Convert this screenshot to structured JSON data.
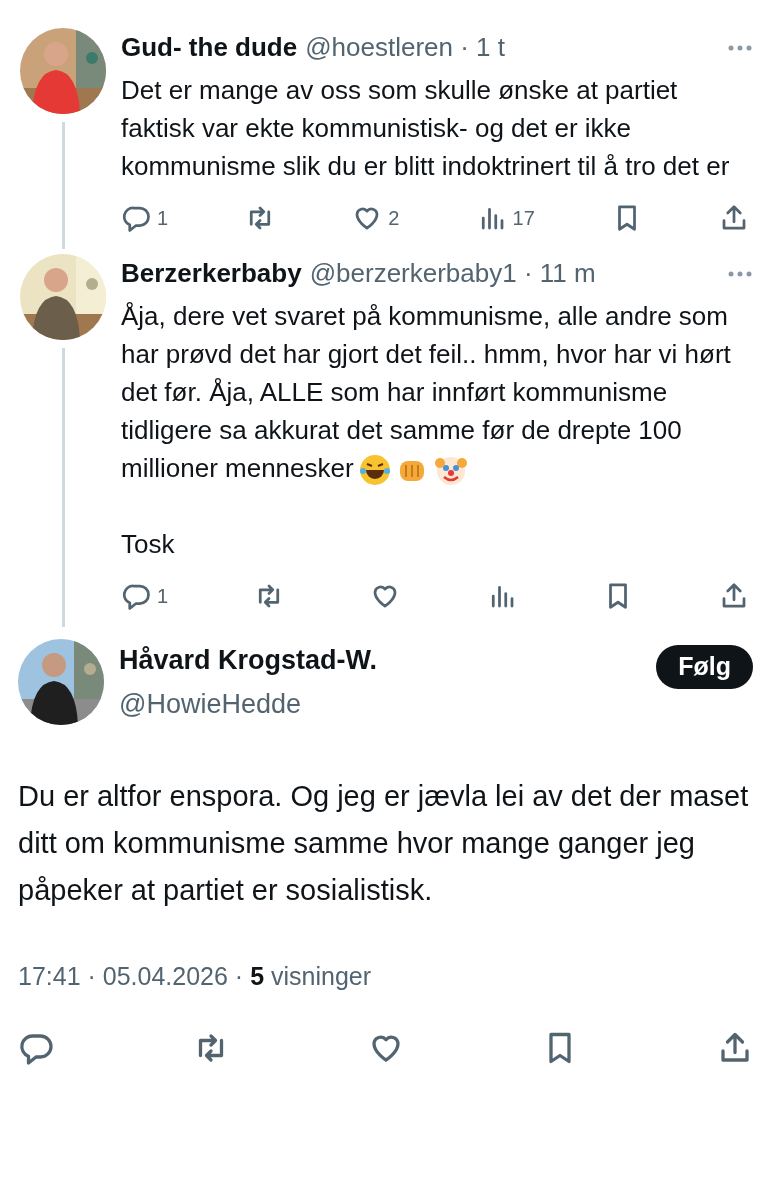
{
  "replies": [
    {
      "name": "Gud- the dude",
      "meta": "@hoestleren · 1 t",
      "paragraphs": [
        "Det er mange av oss som skulle ønske at partiet faktisk var ekte kommunistisk- og det er ikke kommunisme slik du er blitt indoktrinert til å tro det er"
      ],
      "reply_count": "1",
      "like_count": "2",
      "view_count": "17",
      "avatar": {
        "kind": "picture"
      }
    },
    {
      "name": "Berzerkerbaby",
      "meta": "@berzerkerbaby1 · 11 m",
      "paragraphs": [
        "Åja, dere vet svaret på kommunisme, alle andre som har prøvd det har gjort det feil.. hmm, hvor har vi hørt det før. Åja, ALLE som har innført kommunisme tidligere sa akkurat det samme før de drepte 100 millioner mennesker",
        "Tosk"
      ],
      "reply_count": "1",
      "avatar": {
        "kind": "picture"
      }
    }
  ],
  "main_tweet": {
    "name": "Håvard Krogstad-W.",
    "handle": "@HowieHedde",
    "follow_button": "Følg",
    "text": "Du er altfor enspora. Og jeg er jævla lei av det der maset ditt om kommunisme samme hvor mange ganger jeg påpeker at partiet er sosialistisk.",
    "meta": "17:41 · 05.04.2026 · **5** visninger",
    "avatar": {
      "kind": "picture"
    }
  }
}
